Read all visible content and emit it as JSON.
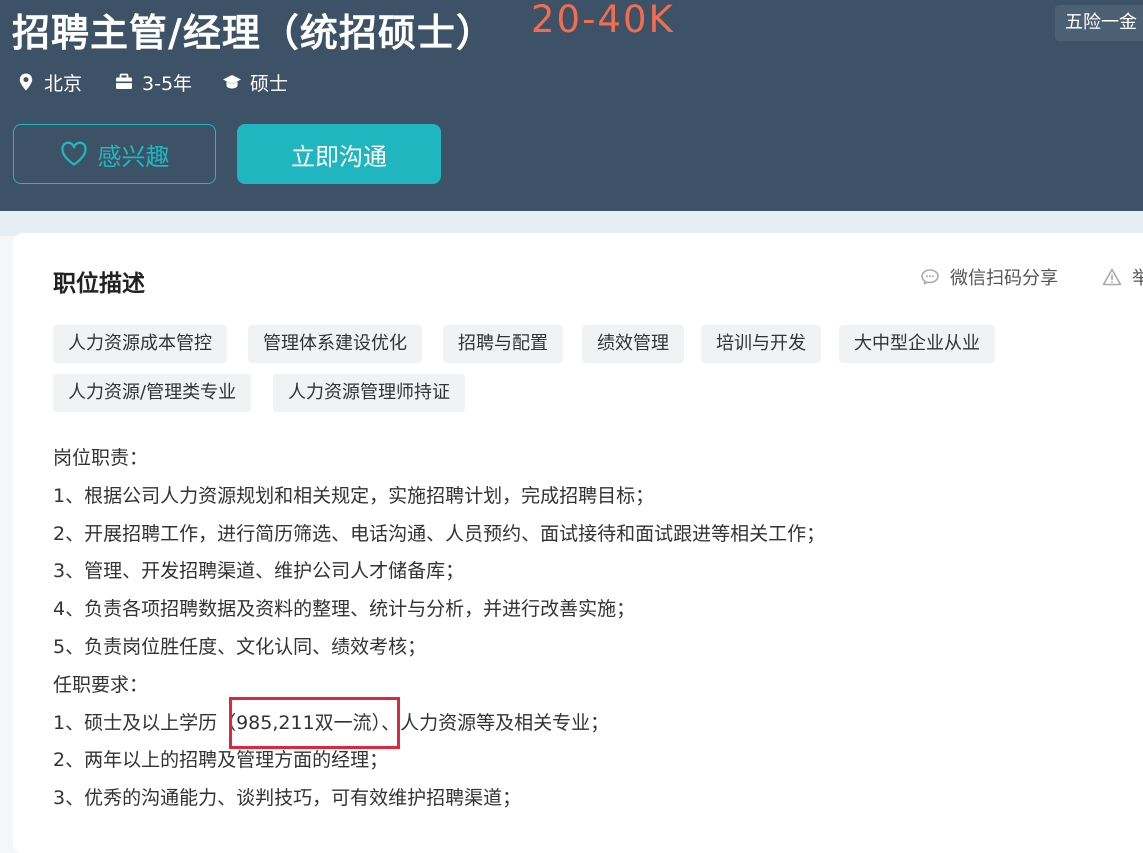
{
  "job": {
    "title": "招聘主管/经理（统招硕士）",
    "salary": "20-40K",
    "welfare_badge": "五险一金",
    "meta": [
      {
        "icon": "location-pin-icon",
        "text": "北京"
      },
      {
        "icon": "briefcase-icon",
        "text": "3-5年"
      },
      {
        "icon": "graduation-cap-icon",
        "text": "硕士"
      }
    ]
  },
  "actions": {
    "interest_label": "感兴趣",
    "chat_label": "立即沟通"
  },
  "description": {
    "section_title": "职位描述",
    "share_label": "微信扫码分享",
    "report_label": "举",
    "tags_row1": [
      "人力资源成本管控",
      "管理体系建设优化",
      "招聘与配置",
      "绩效管理",
      "培训与开发",
      "大中型企业从业"
    ],
    "tags_row2": [
      "人力资源/管理类专业",
      "人力资源管理师持证"
    ],
    "lines": [
      "岗位职责：",
      "1、根据公司人力资源规划和相关规定，实施招聘计划，完成招聘目标；",
      "2、开展招聘工作，进行简历筛选、电话沟通、人员预约、面试接待和面试跟进等相关工作；",
      "3、管理、开发招聘渠道、维护公司人才储备库；",
      "4、负责各项招聘数据及资料的整理、统计与分析，并进行改善实施；",
      "5、负责岗位胜任度、文化认同、绩效考核；",
      "任职要求：",
      "1、硕士及以上学历（985,211双一流）、人力资源等及相关专业；",
      "2、两年以上的招聘及管理方面的经理；",
      "3、优秀的沟通能力、谈判技巧，可有效维护招聘渠道；"
    ]
  },
  "colors": {
    "header_bg": "#3d5266",
    "salary": "#f26d4f",
    "accent": "#1fb6c0",
    "highlight": "#e0253f"
  }
}
